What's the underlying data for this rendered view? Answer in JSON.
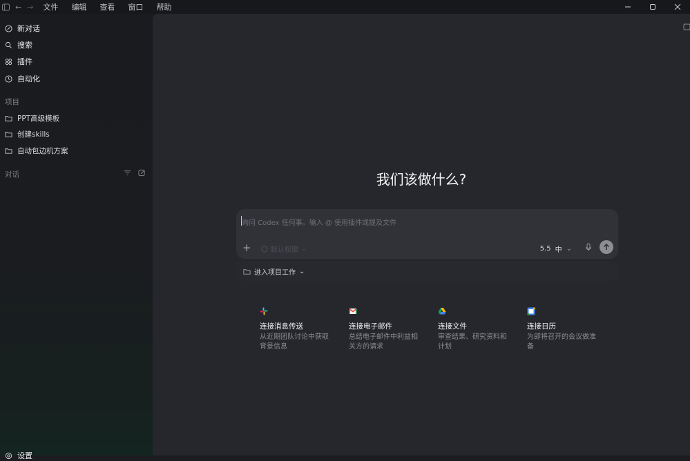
{
  "titlebar": {
    "menus": [
      "文件",
      "编辑",
      "查看",
      "窗口",
      "帮助"
    ]
  },
  "sidebar": {
    "nav": {
      "new_chat": "新对话",
      "search": "搜索",
      "plugins": "插件",
      "automation": "自动化"
    },
    "projects_label": "项目",
    "projects": [
      "PPT高级模板",
      "创建skills",
      "自动包边机方案"
    ],
    "conversations_label": "对话",
    "settings": "设置"
  },
  "main": {
    "heading": "我们该做什么?",
    "composer": {
      "placeholder": "询问 Codex 任何事。输入 @ 使用插件或提及文件",
      "permission": "默认权限",
      "model": "5.5",
      "effort": "中"
    },
    "project_button": "进入项目工作",
    "cards": [
      {
        "title": "连接消息传送",
        "desc": "从近期团队讨论中获取背景信息",
        "icon": "slack-icon"
      },
      {
        "title": "连接电子邮件",
        "desc": "总结电子邮件中利益相关方的请求",
        "icon": "gmail-icon"
      },
      {
        "title": "连接文件",
        "desc": "审查结果、研究资料和计划",
        "icon": "drive-icon"
      },
      {
        "title": "连接日历",
        "desc": "为即将召开的会议做准备",
        "icon": "calendar-icon"
      }
    ]
  },
  "colors": {
    "background": "#1b1c20",
    "main_panel": "#26272c",
    "composer": "#313238",
    "send_button": "#8d8e93"
  }
}
